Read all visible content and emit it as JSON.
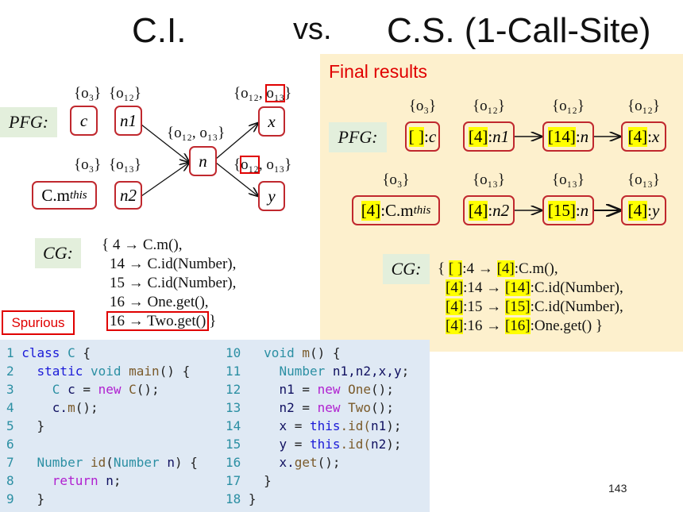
{
  "title": {
    "left": "C.I.",
    "vs": "vs.",
    "right": "C.S. (1-Call-Site)"
  },
  "ci": {
    "pfg_label": "PFG:",
    "cg_label": "CG:",
    "nodes": [
      {
        "id": "c",
        "var": "c",
        "set": "{o₃}"
      },
      {
        "id": "n1",
        "var": "n1",
        "set": "{o₁₂}"
      },
      {
        "id": "cmthis",
        "var": "C.m",
        "sub": "this",
        "set": "{o₃}"
      },
      {
        "id": "n2",
        "var": "n2",
        "set": "{o₁₃}"
      },
      {
        "id": "n",
        "var": "n",
        "set": "{o₁₂, o₁₃}"
      },
      {
        "id": "x",
        "var": "x",
        "set_pre": "{o₁₂, ",
        "set_hl": "o₁₃",
        "set_post": "}"
      },
      {
        "id": "y",
        "var": "y",
        "set_pre": "{",
        "set_hl": "o₁₂",
        "set_post": ", o₁₃}"
      }
    ],
    "cg_lines": [
      "{ 4 → C.m(),",
      "14 → C.id(Number),",
      "15 → C.id(Number),",
      "16 → One.get(),"
    ],
    "cg_spurious_line": "16 → Two.get()",
    "cg_close": "}",
    "spurious_label": "Spurious"
  },
  "cs": {
    "heading": "Final results",
    "pfg_label": "PFG:",
    "cg_label": "CG:",
    "nodes": [
      {
        "ctx": "[ ]",
        "var": "c",
        "set": "{o₃}"
      },
      {
        "ctx": "[4]",
        "var": "n1",
        "set": "{o₁₂}"
      },
      {
        "ctx": "[14]",
        "var": "n",
        "set": "{o₁₂}"
      },
      {
        "ctx": "[4]",
        "var": "x",
        "set": "{o₁₂}"
      },
      {
        "ctx": "[4]",
        "var": "C.m",
        "sub": "this",
        "set": "{o₃}"
      },
      {
        "ctx": "[4]",
        "var": "n2",
        "set": "{o₁₃}"
      },
      {
        "ctx": "[15]",
        "var": "n",
        "set": "{o₁₃}"
      },
      {
        "ctx": "[4]",
        "var": "y",
        "set": "{o₁₃}"
      }
    ],
    "cg_lines": [
      {
        "open": "{ ",
        "c1": "[ ]",
        "site": ":4 → ",
        "c2": "[4]",
        "method": ":C.m(),"
      },
      {
        "open": "",
        "c1": "[4]",
        "site": ":14 → ",
        "c2": "[14]",
        "method": ":C.id(Number),"
      },
      {
        "open": "",
        "c1": "[4]",
        "site": ":15 → ",
        "c2": "[15]",
        "method": ":C.id(Number),"
      },
      {
        "open": "",
        "c1": "[4]",
        "site": ":16 → ",
        "c2": "[16]",
        "method": ":One.get() }"
      }
    ]
  },
  "code": {
    "left": [
      [
        [
          "1 ",
          "ln"
        ],
        [
          "class ",
          "kw"
        ],
        [
          "C ",
          "ty"
        ],
        [
          "{",
          "pl"
        ]
      ],
      [
        [
          "2 ",
          "ln"
        ],
        [
          "  static ",
          "kw"
        ],
        [
          "void ",
          "ty"
        ],
        [
          "main",
          "fn"
        ],
        [
          "() {",
          "pl"
        ]
      ],
      [
        [
          "3 ",
          "ln"
        ],
        [
          "    C ",
          "ty"
        ],
        [
          "c ",
          "id"
        ],
        [
          "= ",
          "pl"
        ],
        [
          "new ",
          "kw2"
        ],
        [
          "C",
          "fn"
        ],
        [
          "();",
          "pl"
        ]
      ],
      [
        [
          "4 ",
          "ln"
        ],
        [
          "    c.",
          "id"
        ],
        [
          "m",
          "fn"
        ],
        [
          "();",
          "pl"
        ]
      ],
      [
        [
          "5 ",
          "ln"
        ],
        [
          "  }",
          "pl"
        ]
      ],
      [
        [
          "6 ",
          "ln"
        ]
      ],
      [
        [
          "7 ",
          "ln"
        ],
        [
          "  Number ",
          "ty"
        ],
        [
          "id",
          "fn"
        ],
        [
          "(",
          "pl"
        ],
        [
          "Number ",
          "ty"
        ],
        [
          "n",
          "id"
        ],
        [
          ") {",
          "pl"
        ]
      ],
      [
        [
          "8 ",
          "ln"
        ],
        [
          "    return ",
          "kw2"
        ],
        [
          "n",
          "id"
        ],
        [
          ";",
          "pl"
        ]
      ],
      [
        [
          "9 ",
          "ln"
        ],
        [
          "  }",
          "pl"
        ]
      ]
    ],
    "right": [
      [
        [
          "10 ",
          "ln"
        ],
        [
          "  void ",
          "ty"
        ],
        [
          "m",
          "fn"
        ],
        [
          "() {",
          "pl"
        ]
      ],
      [
        [
          "11 ",
          "ln"
        ],
        [
          "    Number ",
          "ty"
        ],
        [
          "n1,n2,x,y",
          "id"
        ],
        [
          ";",
          "pl"
        ]
      ],
      [
        [
          "12 ",
          "ln"
        ],
        [
          "    n1 ",
          "id"
        ],
        [
          "= ",
          "pl"
        ],
        [
          "new ",
          "kw2"
        ],
        [
          "One",
          "fn"
        ],
        [
          "();",
          "pl"
        ]
      ],
      [
        [
          "13 ",
          "ln"
        ],
        [
          "    n2 ",
          "id"
        ],
        [
          "= ",
          "pl"
        ],
        [
          "new ",
          "kw2"
        ],
        [
          "Two",
          "fn"
        ],
        [
          "();",
          "pl"
        ]
      ],
      [
        [
          "14 ",
          "ln"
        ],
        [
          "    x ",
          "id"
        ],
        [
          "= ",
          "pl"
        ],
        [
          "this",
          "kw"
        ],
        [
          ".id(",
          "fn"
        ],
        [
          "n1",
          "id"
        ],
        [
          ");",
          "pl"
        ]
      ],
      [
        [
          "15 ",
          "ln"
        ],
        [
          "    y ",
          "id"
        ],
        [
          "= ",
          "pl"
        ],
        [
          "this",
          "kw"
        ],
        [
          ".id(",
          "fn"
        ],
        [
          "n2",
          "id"
        ],
        [
          ");",
          "pl"
        ]
      ],
      [
        [
          "16 ",
          "ln"
        ],
        [
          "    x.",
          "id"
        ],
        [
          "get",
          "fn"
        ],
        [
          "();",
          "pl"
        ]
      ],
      [
        [
          "17 ",
          "ln"
        ],
        [
          "  }",
          "pl"
        ]
      ],
      [
        [
          "18 ",
          "ln"
        ],
        [
          "}",
          "pl"
        ]
      ]
    ]
  },
  "page_number": "143",
  "colors": {
    "accent_red": "#e00000",
    "node_border": "#c0282e",
    "panel_bg": "#fdf0cd",
    "context_highlight": "#ffff00",
    "tag_bg": "#e3efdc",
    "code_bg": "#dfe9f4"
  }
}
